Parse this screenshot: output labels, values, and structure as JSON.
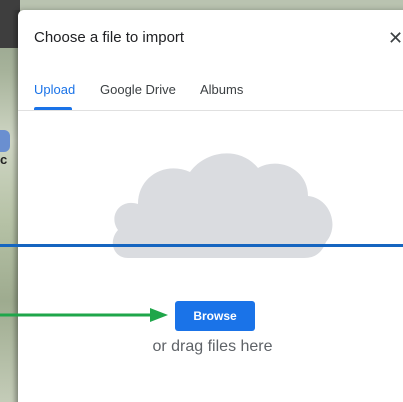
{
  "dialog": {
    "title": "Choose a file to import",
    "close_glyph": "✕"
  },
  "tabs": [
    {
      "label": "Upload",
      "active": true
    },
    {
      "label": "Google Drive",
      "active": false
    },
    {
      "label": "Albums",
      "active": false
    }
  ],
  "upload": {
    "illustration": "cloud-icon",
    "browse_label": "Browse",
    "drag_text": "or drag files here"
  },
  "map": {
    "label": "c"
  },
  "colors": {
    "accent": "#1a73e8",
    "annotation_line": "#1565c0",
    "annotation_arrow": "#1fa64a",
    "cloud": "#dadce0"
  }
}
